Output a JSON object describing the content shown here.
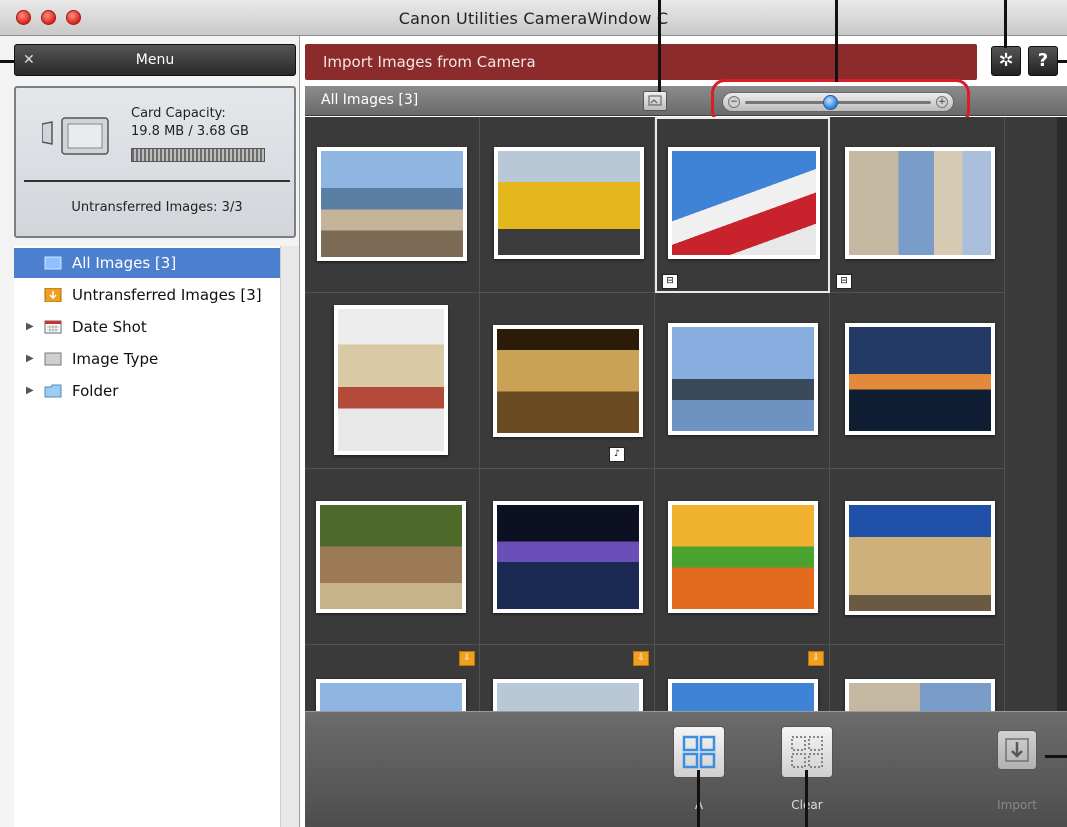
{
  "window": {
    "title": "Canon Utilities CameraWindow  C"
  },
  "sidebar": {
    "menu_label": "Menu",
    "close_glyph": "✕",
    "capacity_label": "Card Capacity:",
    "capacity_value": "19.8 MB / 3.68 GB",
    "untransferred_label": "Untransferred Images:  3/3",
    "tree": [
      {
        "label": "All Images [3]",
        "icon": "all-images-icon"
      },
      {
        "label": "Untransferred Images [3]",
        "icon": "untransferred-icon"
      },
      {
        "label": "Date Shot",
        "icon": "calendar-icon"
      },
      {
        "label": "Image Type",
        "icon": "image-type-icon"
      },
      {
        "label": "Folder",
        "icon": "folder-icon"
      }
    ]
  },
  "header": {
    "title": "Import Images from Camera",
    "settings_glyph": "✲",
    "help_glyph": "?"
  },
  "gallery": {
    "title": "All Images [3]",
    "zoom_level": 0.45,
    "thumbnails": [
      {
        "scene": "harbor-market"
      },
      {
        "scene": "yellow-train"
      },
      {
        "scene": "street-signs"
      },
      {
        "scene": "city-building"
      },
      {
        "scene": "hat-on-chair"
      },
      {
        "scene": "qvb-interior"
      },
      {
        "scene": "harbour-bridge"
      },
      {
        "scene": "sunset-bridge"
      },
      {
        "scene": "wallaby"
      },
      {
        "scene": "night-harbour"
      },
      {
        "scene": "vegetable-sticks"
      },
      {
        "scene": "old-building"
      },
      {
        "scene": "harbor-market-2"
      },
      {
        "scene": "yellow-train-2"
      },
      {
        "scene": "street-signs-2"
      },
      {
        "scene": "city-building-2"
      }
    ]
  },
  "toolbar": {
    "select_all_label": "A",
    "clear_label": "Clear",
    "import_label": "Import"
  },
  "colors": {
    "header_red": "#8b2b2b",
    "selection_blue": "#4d7fcf",
    "callout_red": "#d81f26"
  }
}
